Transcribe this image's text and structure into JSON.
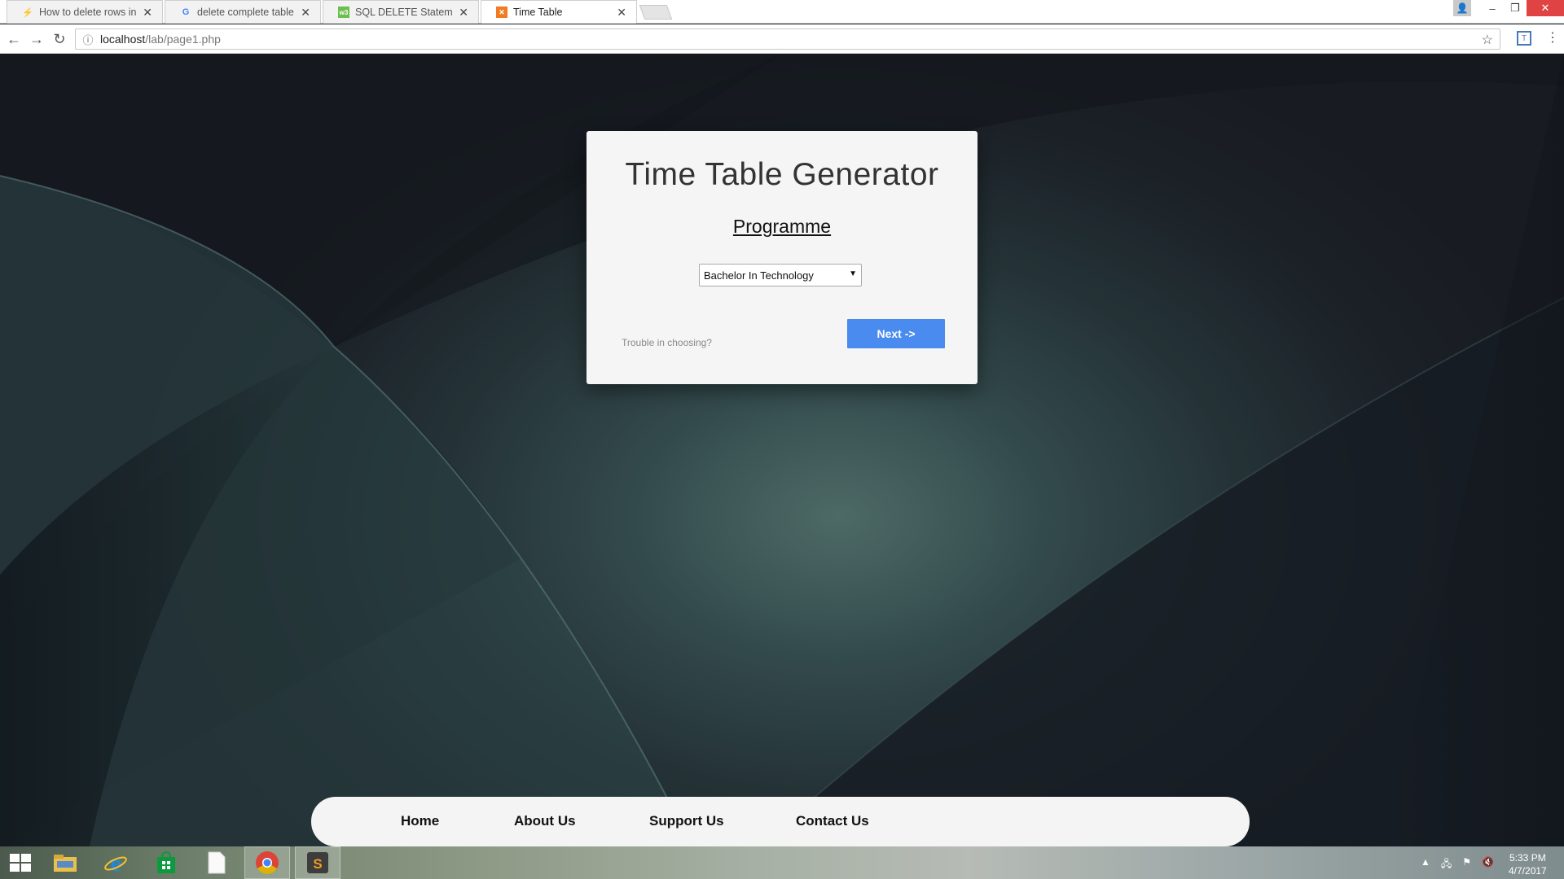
{
  "browser": {
    "tabs": [
      {
        "title": "How to delete rows in m",
        "favicon": "stackoverflow-icon",
        "active": false
      },
      {
        "title": "delete complete table in",
        "favicon": "google-icon",
        "active": false
      },
      {
        "title": "SQL DELETE Statement",
        "favicon": "w3schools-icon",
        "active": false
      },
      {
        "title": "Time Table",
        "favicon": "xampp-icon",
        "active": true
      }
    ],
    "address": {
      "host": "localhost",
      "path": "/lab/page1.php"
    }
  },
  "page": {
    "title": "Time Table Generator",
    "section_heading": "Programme",
    "programme_select": {
      "selected": "Bachelor In Technology"
    },
    "help_link": "Trouble in choosing?",
    "next_button": "Next ->",
    "footer_nav": [
      "Home",
      "About Us",
      "Support Us",
      "Contact Us"
    ]
  },
  "taskbar": {
    "pinned": [
      "file-explorer-icon",
      "internet-explorer-icon",
      "store-icon",
      "document-icon",
      "chrome-icon",
      "sublime-text-icon"
    ],
    "active_apps": [
      "chrome-icon",
      "sublime-text-icon"
    ],
    "clock": {
      "time": "5:33 PM",
      "date": "4/7/2017"
    }
  },
  "colors": {
    "next_button": "#4a8bf0",
    "card_bg": "#f5f5f5",
    "close_window": "#e04343"
  }
}
